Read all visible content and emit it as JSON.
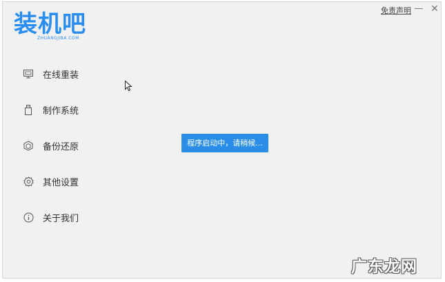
{
  "brand": {
    "logo_text": "装机吧",
    "logo_sub": "ZHUANGJIBA.COM",
    "accent": "#2a8df0"
  },
  "titlebar": {
    "disclaimer": "免责声明",
    "minimize_glyph": "—",
    "close_glyph": "✕"
  },
  "sidebar": {
    "items": [
      {
        "label": "在线重装",
        "icon": "monitor-icon"
      },
      {
        "label": "制作系统",
        "icon": "usb-drive-icon"
      },
      {
        "label": "备份还原",
        "icon": "backup-icon"
      },
      {
        "label": "其他设置",
        "icon": "gear-icon"
      },
      {
        "label": "关于我们",
        "icon": "info-icon"
      }
    ]
  },
  "toast": {
    "text": "程序启动中，请稍候...",
    "color": "#2a8ee8"
  },
  "watermark": {
    "text": "广东龙网"
  }
}
